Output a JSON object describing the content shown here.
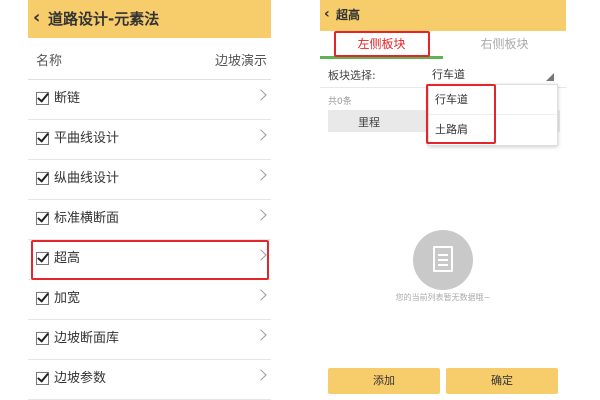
{
  "left_screen": {
    "header": {
      "back_glyph": "‹",
      "title": "道路设计-元素法"
    },
    "columns": {
      "name": "名称",
      "demo": "边坡演示"
    },
    "items": [
      {
        "label": "断链",
        "checked": true
      },
      {
        "label": "平曲线设计",
        "checked": true
      },
      {
        "label": "纵曲线设计",
        "checked": true
      },
      {
        "label": "标准横断面",
        "checked": true
      },
      {
        "label": "超高",
        "checked": true,
        "highlighted": true
      },
      {
        "label": "加宽",
        "checked": true
      },
      {
        "label": "边坡断面库",
        "checked": true
      },
      {
        "label": "边坡参数",
        "checked": true
      }
    ]
  },
  "right_screen": {
    "header": {
      "back_glyph": "‹",
      "title": "超高"
    },
    "tabs": [
      {
        "label": "左侧板块",
        "active": true
      },
      {
        "label": "右侧板块",
        "active": false
      }
    ],
    "block_select": {
      "label": "板块选择:",
      "value": "行车道"
    },
    "count_text": "共0条",
    "table_header": {
      "col1": "里程"
    },
    "dropdown_options": [
      "行车道",
      "土路肩"
    ],
    "empty_text": "您的当前列表暂无数据哦~",
    "buttons": {
      "add": "添加",
      "confirm": "确定"
    }
  },
  "colors": {
    "header_bg": "#f7cd6c",
    "highlight_red": "#e3262a",
    "tab_green": "#5fb356"
  }
}
